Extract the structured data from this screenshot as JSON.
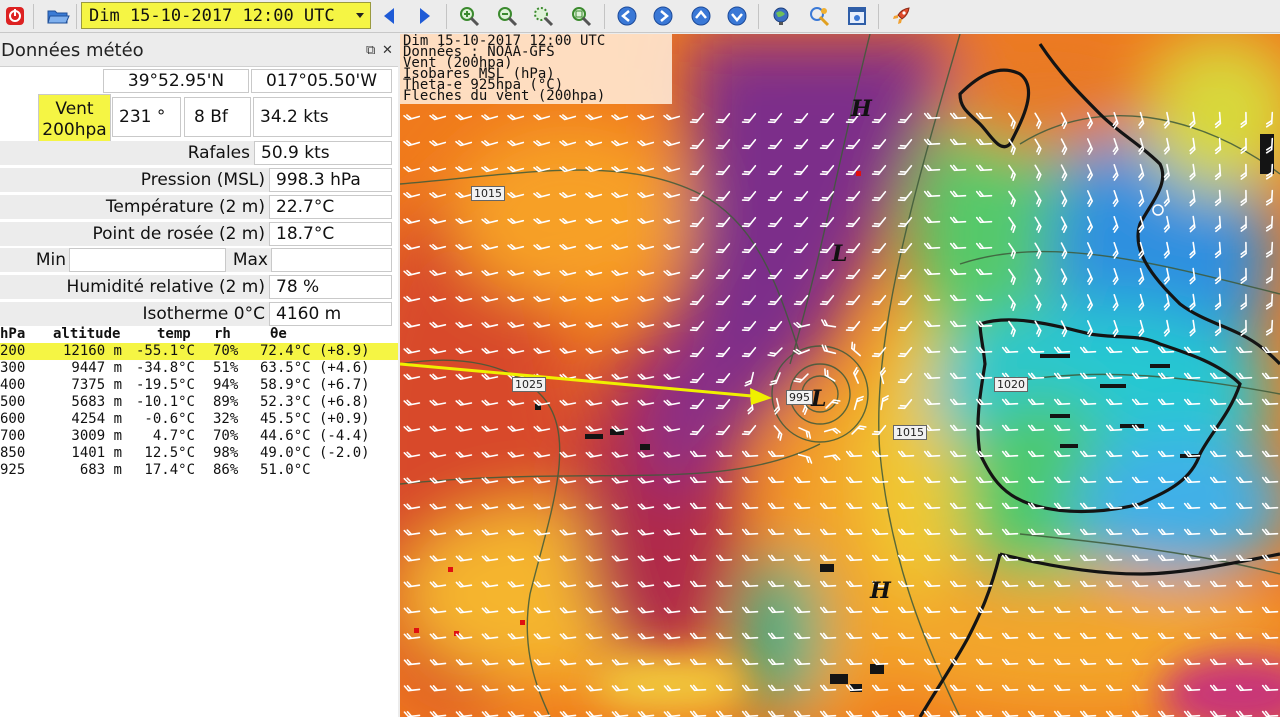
{
  "toolbar": {
    "date_value": "Dim 15-10-2017 12:00 UTC",
    "icons": [
      "power-icon",
      "open-folder-icon",
      "prev-arrow-icon",
      "next-arrow-icon",
      "zoom-in-icon",
      "zoom-out-icon",
      "zoom-box-icon",
      "zoom-fit-icon",
      "nav-left-icon",
      "nav-right-icon",
      "nav-up-icon",
      "nav-down-icon",
      "globe-icon",
      "overlay-icon",
      "window-icon",
      "rocket-icon"
    ]
  },
  "panel": {
    "title": "Données météo",
    "latitude": "39°52.95'N",
    "longitude": "017°05.50'W",
    "wind_label": "Vent\n200hpa",
    "wind_dir": "231 °",
    "wind_bf": "8 Bf",
    "wind_speed": "34.2  kts",
    "gusts_label": "Rafales",
    "gusts_value": "50.9  kts",
    "pressure_label": "Pression (MSL)",
    "pressure_value": "998.3 hPa",
    "temp_label": "Température (2 m)",
    "temp_value": "22.7°C",
    "dew_label": "Point de rosée (2 m)",
    "dew_value": "18.7°C",
    "min_label": "Min",
    "max_label": "Max",
    "humidity_label": "Humidité relative (2 m)",
    "humidity_value": "78 %",
    "iso_label": "Isotherme 0°C",
    "iso_value": "4160 m",
    "table": {
      "headers": [
        "hPa",
        "altitude",
        "temp",
        "rh",
        "θe"
      ],
      "rows": [
        [
          "200",
          "12160 m",
          "-55.1°C",
          "70%",
          "72.4°C (+8.9)"
        ],
        [
          "300",
          "9447 m",
          "-34.8°C",
          "51%",
          "63.5°C (+4.6)"
        ],
        [
          "400",
          "7375 m",
          "-19.5°C",
          "94%",
          "58.9°C (+6.7)"
        ],
        [
          "500",
          "5683 m",
          "-10.1°C",
          "89%",
          "52.3°C (+6.8)"
        ],
        [
          "600",
          "4254 m",
          "-0.6°C",
          "32%",
          "45.5°C (+0.9)"
        ],
        [
          "700",
          "3009 m",
          "4.7°C",
          "70%",
          "44.6°C (-4.4)"
        ],
        [
          "850",
          "1401 m",
          "12.5°C",
          "98%",
          "49.0°C (-2.0)"
        ],
        [
          "925",
          "683 m",
          "17.4°C",
          "86%",
          "51.0°C"
        ]
      ]
    }
  },
  "map": {
    "legend": [
      "Dim 15-10-2017 12:00 UTC",
      "Données : NOAA-GFS",
      "Vent (200hpa)",
      "Isobares MSL (hPa)",
      "Theta-e 925hpa (°C)",
      "Fleches du vent (200hpa)"
    ],
    "isobars": [
      "1015",
      "1025",
      "995",
      "1015",
      "1020"
    ],
    "marks": [
      "H",
      "L",
      "L",
      "H"
    ],
    "colors": {
      "highlight": "#f5f544",
      "arrow": "#f0f000"
    }
  }
}
